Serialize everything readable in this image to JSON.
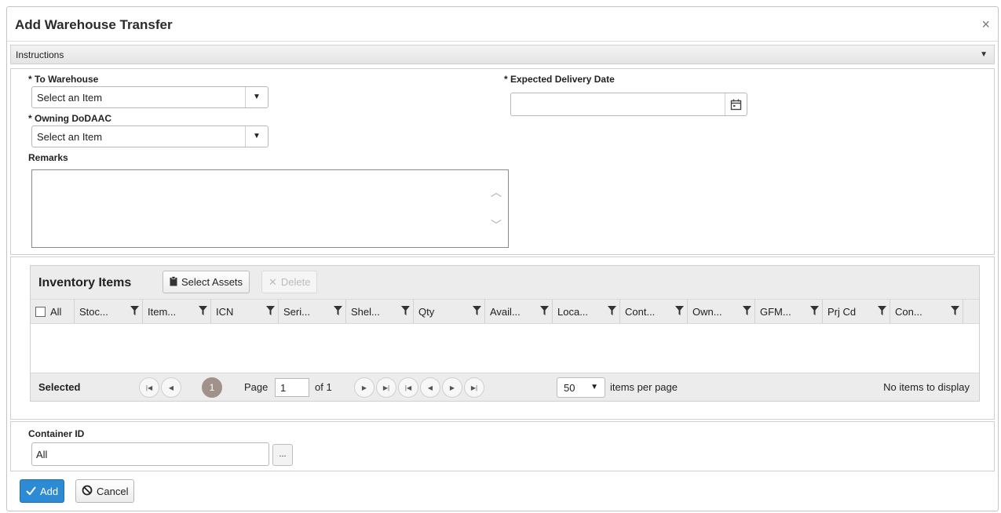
{
  "dialog": {
    "title": "Add Warehouse Transfer",
    "close": "×"
  },
  "instructions": {
    "label": "Instructions"
  },
  "form": {
    "to_warehouse": {
      "label": "* To Warehouse",
      "value": "Select an Item"
    },
    "owning_dodaac": {
      "label": "* Owning DoDAAC",
      "value": "Select an Item"
    },
    "remarks": {
      "label": "Remarks",
      "value": ""
    },
    "expected_delivery_date": {
      "label": "* Expected Delivery Date",
      "value": ""
    }
  },
  "inventory": {
    "title": "Inventory Items",
    "select_assets": "Select Assets",
    "delete": "Delete",
    "columns": [
      "All",
      "Stoc...",
      "Item...",
      "ICN",
      "Seri...",
      "Shel...",
      "Qty",
      "Avail...",
      "Loca...",
      "Cont...",
      "Own...",
      "GFM...",
      "Prj Cd",
      "Con..."
    ],
    "footer": {
      "selected": "Selected",
      "current_page": "1",
      "page_label": "Page",
      "page_input": "1",
      "of_label": "of 1",
      "per_page": "50",
      "per_page_label": "items per page",
      "no_items": "No items to display"
    }
  },
  "container": {
    "label": "Container ID",
    "value": "All",
    "browse": "..."
  },
  "actions": {
    "add": "Add",
    "cancel": "Cancel"
  },
  "colors": {
    "primary": "#2d8bd6",
    "current_page": "#a0928a"
  }
}
